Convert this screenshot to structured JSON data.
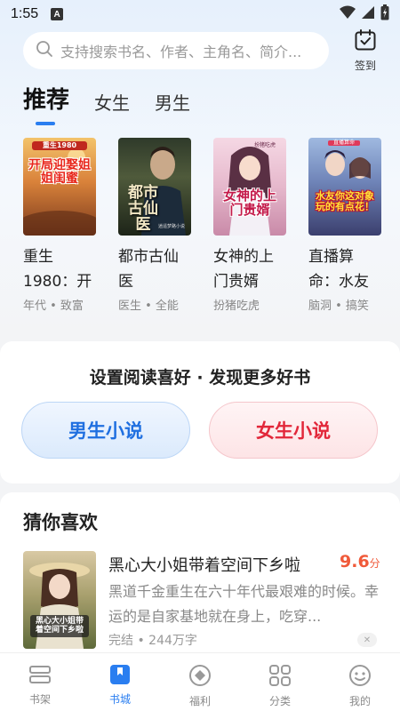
{
  "status": {
    "time": "1:55",
    "badge": "A"
  },
  "search": {
    "placeholder": "支持搜索书名、作者、主角名、简介..."
  },
  "signin": {
    "label": "签到"
  },
  "tabs": [
    {
      "label": "推荐"
    },
    {
      "label": "女生"
    },
    {
      "label": "男生"
    }
  ],
  "books": [
    {
      "title": "重生1980：开",
      "tags": "年代 • 致富",
      "cover_top": "重生1980",
      "cover_text": "开局迎娶姐姐闺蜜"
    },
    {
      "title": "都市古仙医",
      "tags": "医生 • 全能",
      "cover_text": "都市古仙医",
      "cover_small": "逍遥梦路小说"
    },
    {
      "title": "女神的上门贵婿",
      "tags": "扮猪吃虎",
      "cover_text": "女神的上门贵婿",
      "cover_top": "扮猪吃虎"
    },
    {
      "title": "直播算命：水友",
      "tags": "脑洞 • 搞笑",
      "cover_top": "直播算命",
      "cover_text": "水友你这对象玩的有点花！"
    }
  ],
  "preference": {
    "title": "设置阅读喜好 · 发现更多好书",
    "male_label": "男生小说",
    "female_label": "女生小说"
  },
  "guess": {
    "section_title": "猜你喜欢",
    "book": {
      "title": "黑心大小姐带着空间下乡啦",
      "score": "9.6",
      "score_unit": "分",
      "description": "黑道千金重生在六十年代最艰难的时候。幸运的是自家基地就在身上，吃穿...",
      "meta": "完结 • 244万字",
      "cover_text": "黑心大小姐带着空间下乡啦"
    }
  },
  "nav": [
    {
      "label": "书架",
      "icon": "bookshelf-icon",
      "active": false
    },
    {
      "label": "书城",
      "icon": "bookstore-icon",
      "active": true
    },
    {
      "label": "福利",
      "icon": "welfare-icon",
      "active": false
    },
    {
      "label": "分类",
      "icon": "category-icon",
      "active": false
    },
    {
      "label": "我的",
      "icon": "profile-icon",
      "active": false
    }
  ],
  "colors": {
    "accent": "#2a7ef0",
    "male": "#1f6fe0",
    "female": "#e2273a",
    "score": "#f05a3a"
  }
}
